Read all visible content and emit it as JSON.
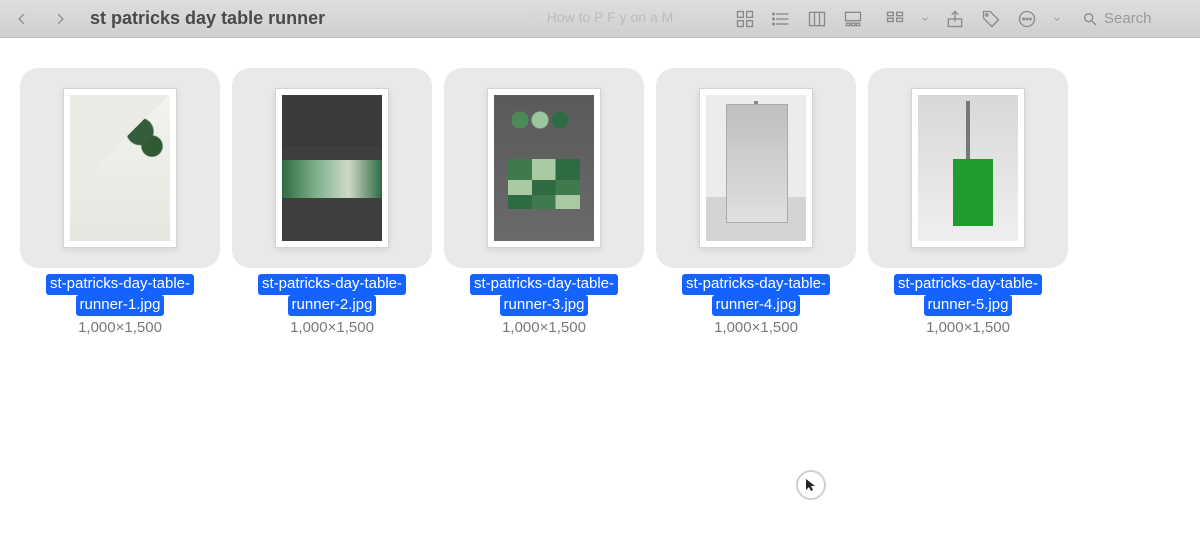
{
  "toolbar": {
    "title": "st patricks day table runner",
    "ghost_text": "How to P               F     y on a M",
    "search_placeholder": "Search"
  },
  "selection_color": "#1463ff",
  "items": [
    {
      "name_line1": "st-patricks-day-table-",
      "name_line2": "runner-1.jpg",
      "dims": "1,000×1,500"
    },
    {
      "name_line1": "st-patricks-day-table-",
      "name_line2": "runner-2.jpg",
      "dims": "1,000×1,500"
    },
    {
      "name_line1": "st-patricks-day-table-",
      "name_line2": "runner-3.jpg",
      "dims": "1,000×1,500"
    },
    {
      "name_line1": "st-patricks-day-table-",
      "name_line2": "runner-4.jpg",
      "dims": "1,000×1,500"
    },
    {
      "name_line1": "st-patricks-day-table-",
      "name_line2": "runner-5.jpg",
      "dims": "1,000×1,500"
    }
  ]
}
